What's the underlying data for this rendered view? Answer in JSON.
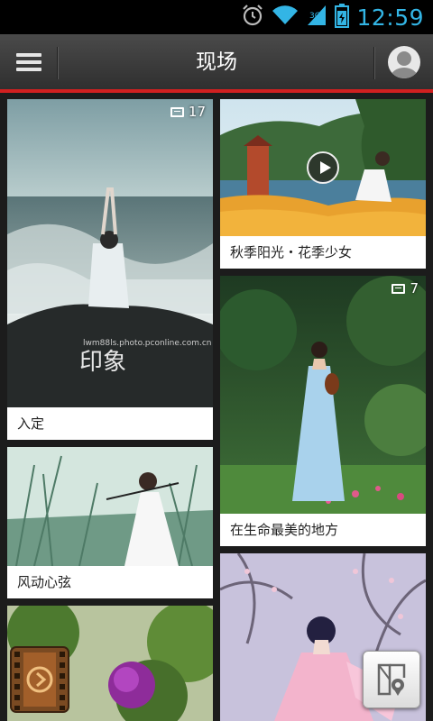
{
  "status_bar": {
    "time": "12:59"
  },
  "action_bar": {
    "title": "现场"
  },
  "cards": [
    {
      "caption": "入定",
      "photo_count": "17"
    },
    {
      "caption": "秋季阳光・花季少女"
    },
    {
      "caption": "在生命最美的地方",
      "photo_count": "7"
    },
    {
      "caption": "风动心弦"
    },
    {
      "caption": ""
    },
    {
      "caption": ""
    }
  ],
  "watermarks": {
    "card1_url": "lwm88ls.photo.pconline.com.cn",
    "card1_logo": "印象"
  },
  "colors": {
    "accent_red": "#d12020",
    "status_blue": "#33b5e5",
    "actionbar": "#3c3c3c"
  },
  "icons": [
    "alarm-icon",
    "wifi-icon",
    "signal-icon",
    "battery-icon",
    "menu-icon",
    "avatar-icon",
    "album-icon",
    "play-icon",
    "video-film-icon",
    "map-icon"
  ]
}
